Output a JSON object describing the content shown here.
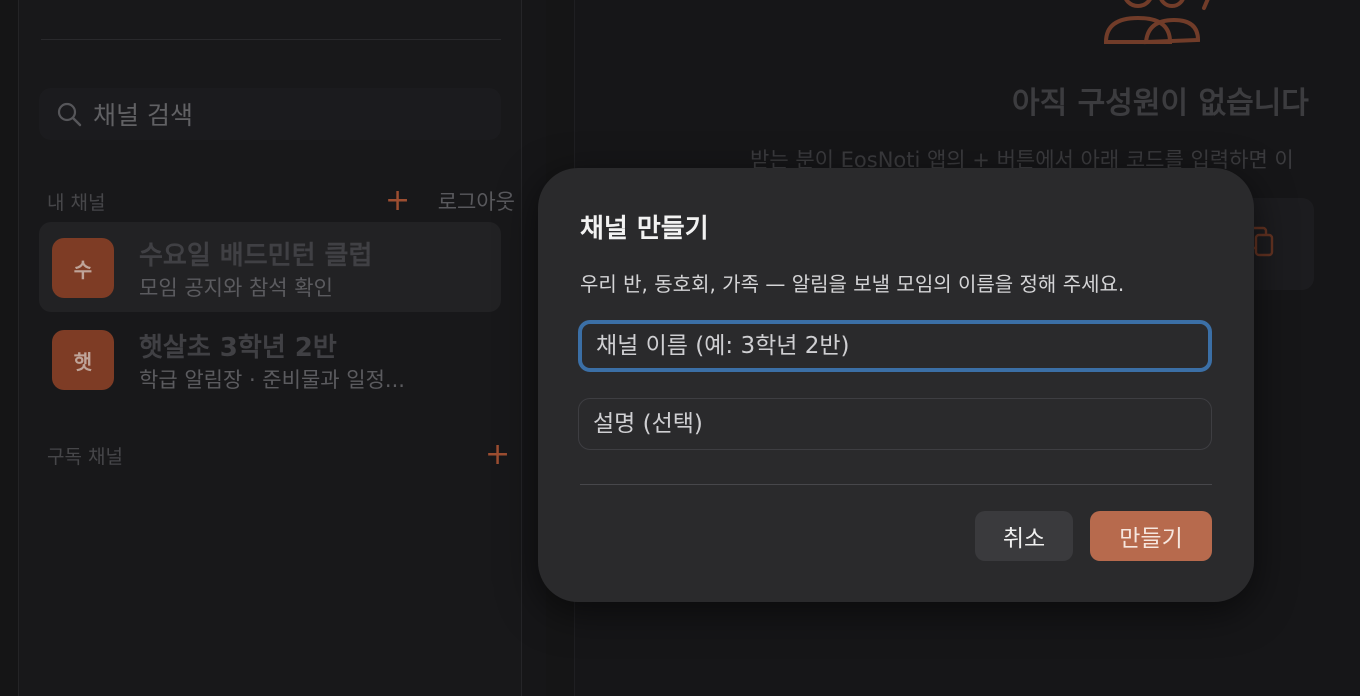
{
  "sidebar": {
    "search": {
      "placeholder": "채널 검색"
    },
    "my_channels": {
      "label": "내 채널",
      "add": "+",
      "logout": "로그아웃"
    },
    "channels": [
      {
        "avatar": "수",
        "title": "수요일 배드민턴 클럽",
        "subtitle": "모임 공지와 참석 확인"
      },
      {
        "avatar": "햇",
        "title": "햇살초 3학년 2반",
        "subtitle": "학급 알림장 · 준비물과 일정..."
      }
    ],
    "subscribed": {
      "label": "구독 채널",
      "add": "+"
    }
  },
  "main": {
    "empty_title": "아직 구성원이 없습니다",
    "empty_desc": "받는 분이 EosNoti 앱의 + 버튼에서 아래 코드를 입력하면 이"
  },
  "modal": {
    "title": "채널 만들기",
    "description": "우리 반, 동호회, 가족 — 알림을 보낼 모임의 이름을 정해 주세요.",
    "name_placeholder": "채널 이름 (예: 3학년 2반)",
    "desc_placeholder": "설명 (선택)",
    "cancel": "취소",
    "create": "만들기"
  },
  "colors": {
    "accent": "#b76a4d",
    "focus": "#3b6fa6"
  },
  "icons": [
    "search-icon",
    "plus-icon",
    "users-icon",
    "copy-icon"
  ]
}
